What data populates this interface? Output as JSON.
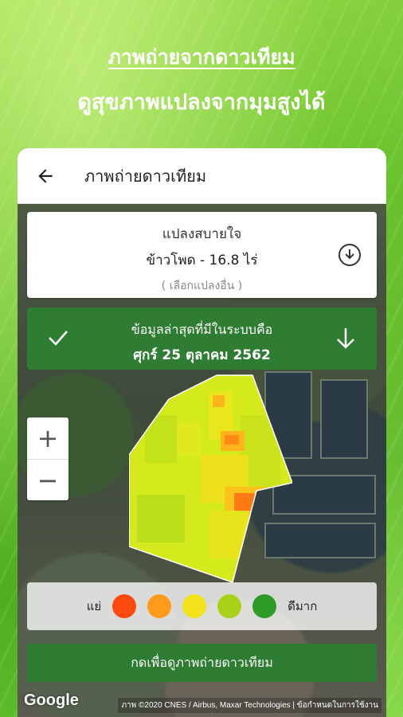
{
  "headline": {
    "line1": "ภาพถ่ายจากดาวเทียม",
    "line2": "ดูสุขภาพแปลงจากมุมสูงได้"
  },
  "appbar": {
    "back_icon": "arrow-left-icon",
    "title": "ภาพถ่ายดาวเทียม"
  },
  "plot_card": {
    "name": "แปลงสบายใจ",
    "crop": "ข้าวโพด - 16.8 ไร่",
    "select_other": "( เลือกแปลงอื่น )",
    "download_icon": "download-circle-icon"
  },
  "latest_bar": {
    "label": "ข้อมูลล่าสุดที่มีในระบบคือ",
    "date": "ศุกร์ 25 ตุลาคม 2562",
    "check_icon": "check-icon",
    "expand_icon": "arrow-down-icon"
  },
  "zoom": {
    "in": "+",
    "out": "−"
  },
  "legend": {
    "low_label": "แย่",
    "high_label": "ดีมาก",
    "colors": [
      "#ff4a12",
      "#ff9a1a",
      "#f2e21a",
      "#a8d21a",
      "#2e9a28"
    ]
  },
  "cta": {
    "label": "กดเพื่อดูภาพถ่ายดาวเทียม"
  },
  "map_footer": {
    "logo": "Google",
    "attribution": "ภาพ ©2020 CNES / Airbus, Maxar Technologies | ข้อกำหนดในการใช้งาน"
  },
  "colors": {
    "primary_green": "#2e7d32",
    "heat_low": "#ff4a12",
    "heat_high": "#2e9a28"
  }
}
